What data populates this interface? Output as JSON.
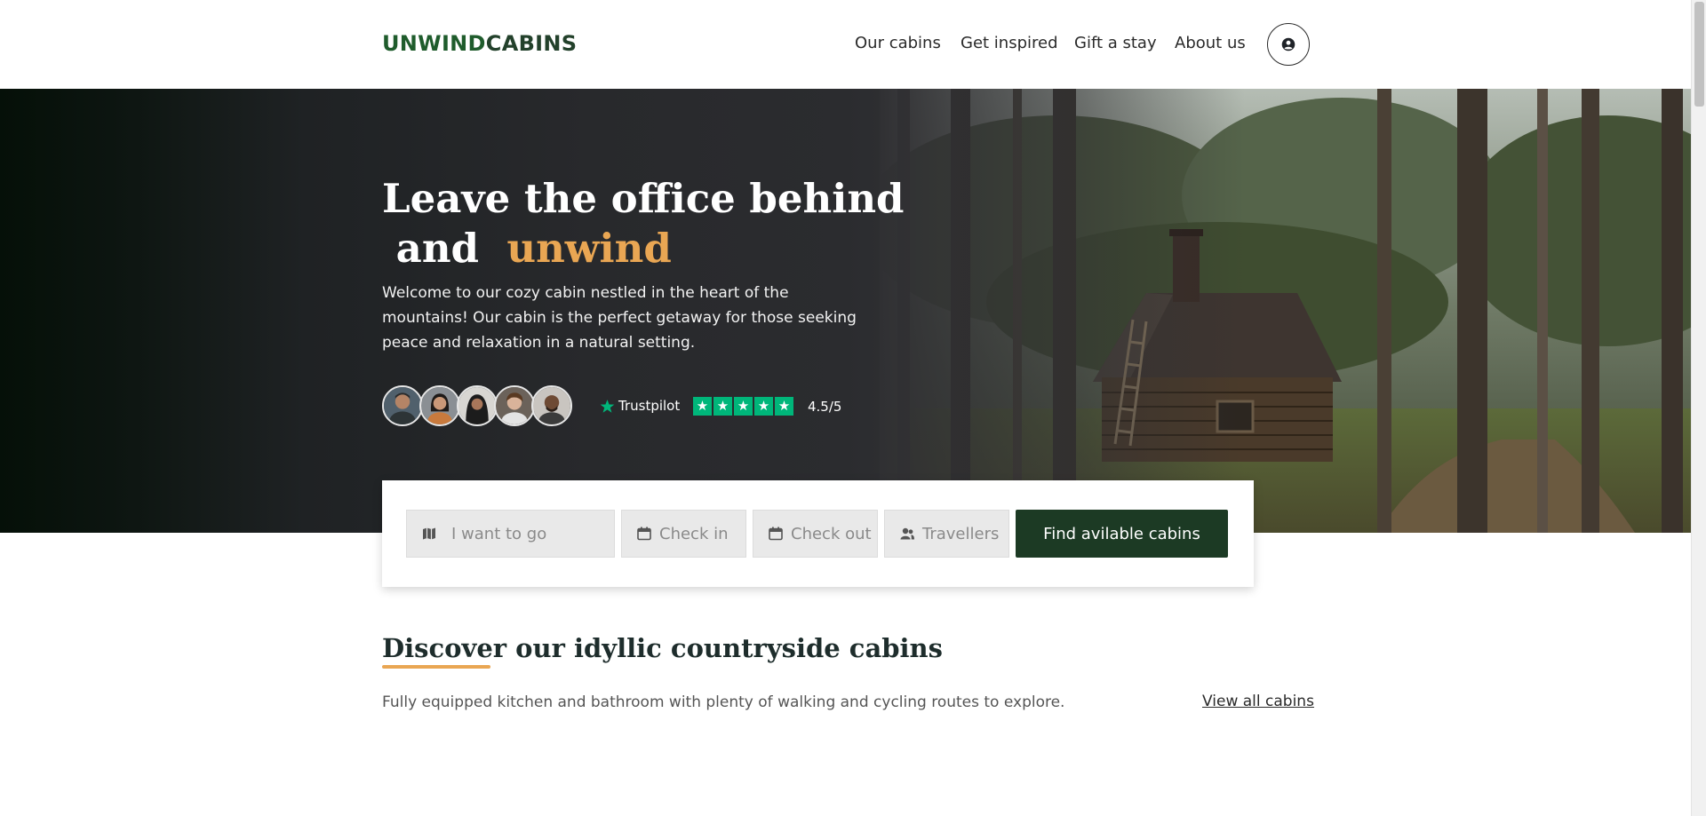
{
  "header": {
    "logo_part1": "UNWIND",
    "logo_part2": "CABINS",
    "nav": [
      "Our cabins",
      "Get inspired",
      "Gift a stay",
      "About us"
    ],
    "account_icon": "user-circle-icon"
  },
  "hero": {
    "title_line1": "Leave the office behind",
    "title_line2_start": "and",
    "title_line2_accent": "unwind",
    "description": "Welcome to our cozy cabin nestled in the heart of the mountains! Our cabin is the perfect getaway for those seeking peace and relaxation in a natural setting.",
    "trustpilot_name": "Trustpilot",
    "rating_stars": 5,
    "rating_text": "4.5/5"
  },
  "search": {
    "where_placeholder": "I want to go",
    "checkin_placeholder": "Check in",
    "checkout_placeholder": "Check out",
    "travellers_placeholder": "Travellers",
    "button_label": "Find avilable cabins"
  },
  "discover": {
    "title": "Discover our idyllic countryside cabins",
    "description": "Fully equipped kitchen and bathroom with plenty of walking and cycling routes to explore.",
    "view_all": "View all cabins"
  },
  "colors": {
    "brand_green": "#1f5c2c",
    "button_green": "#1c3a24",
    "accent_orange": "#e9a653",
    "trustpilot_green": "#00b67a"
  }
}
